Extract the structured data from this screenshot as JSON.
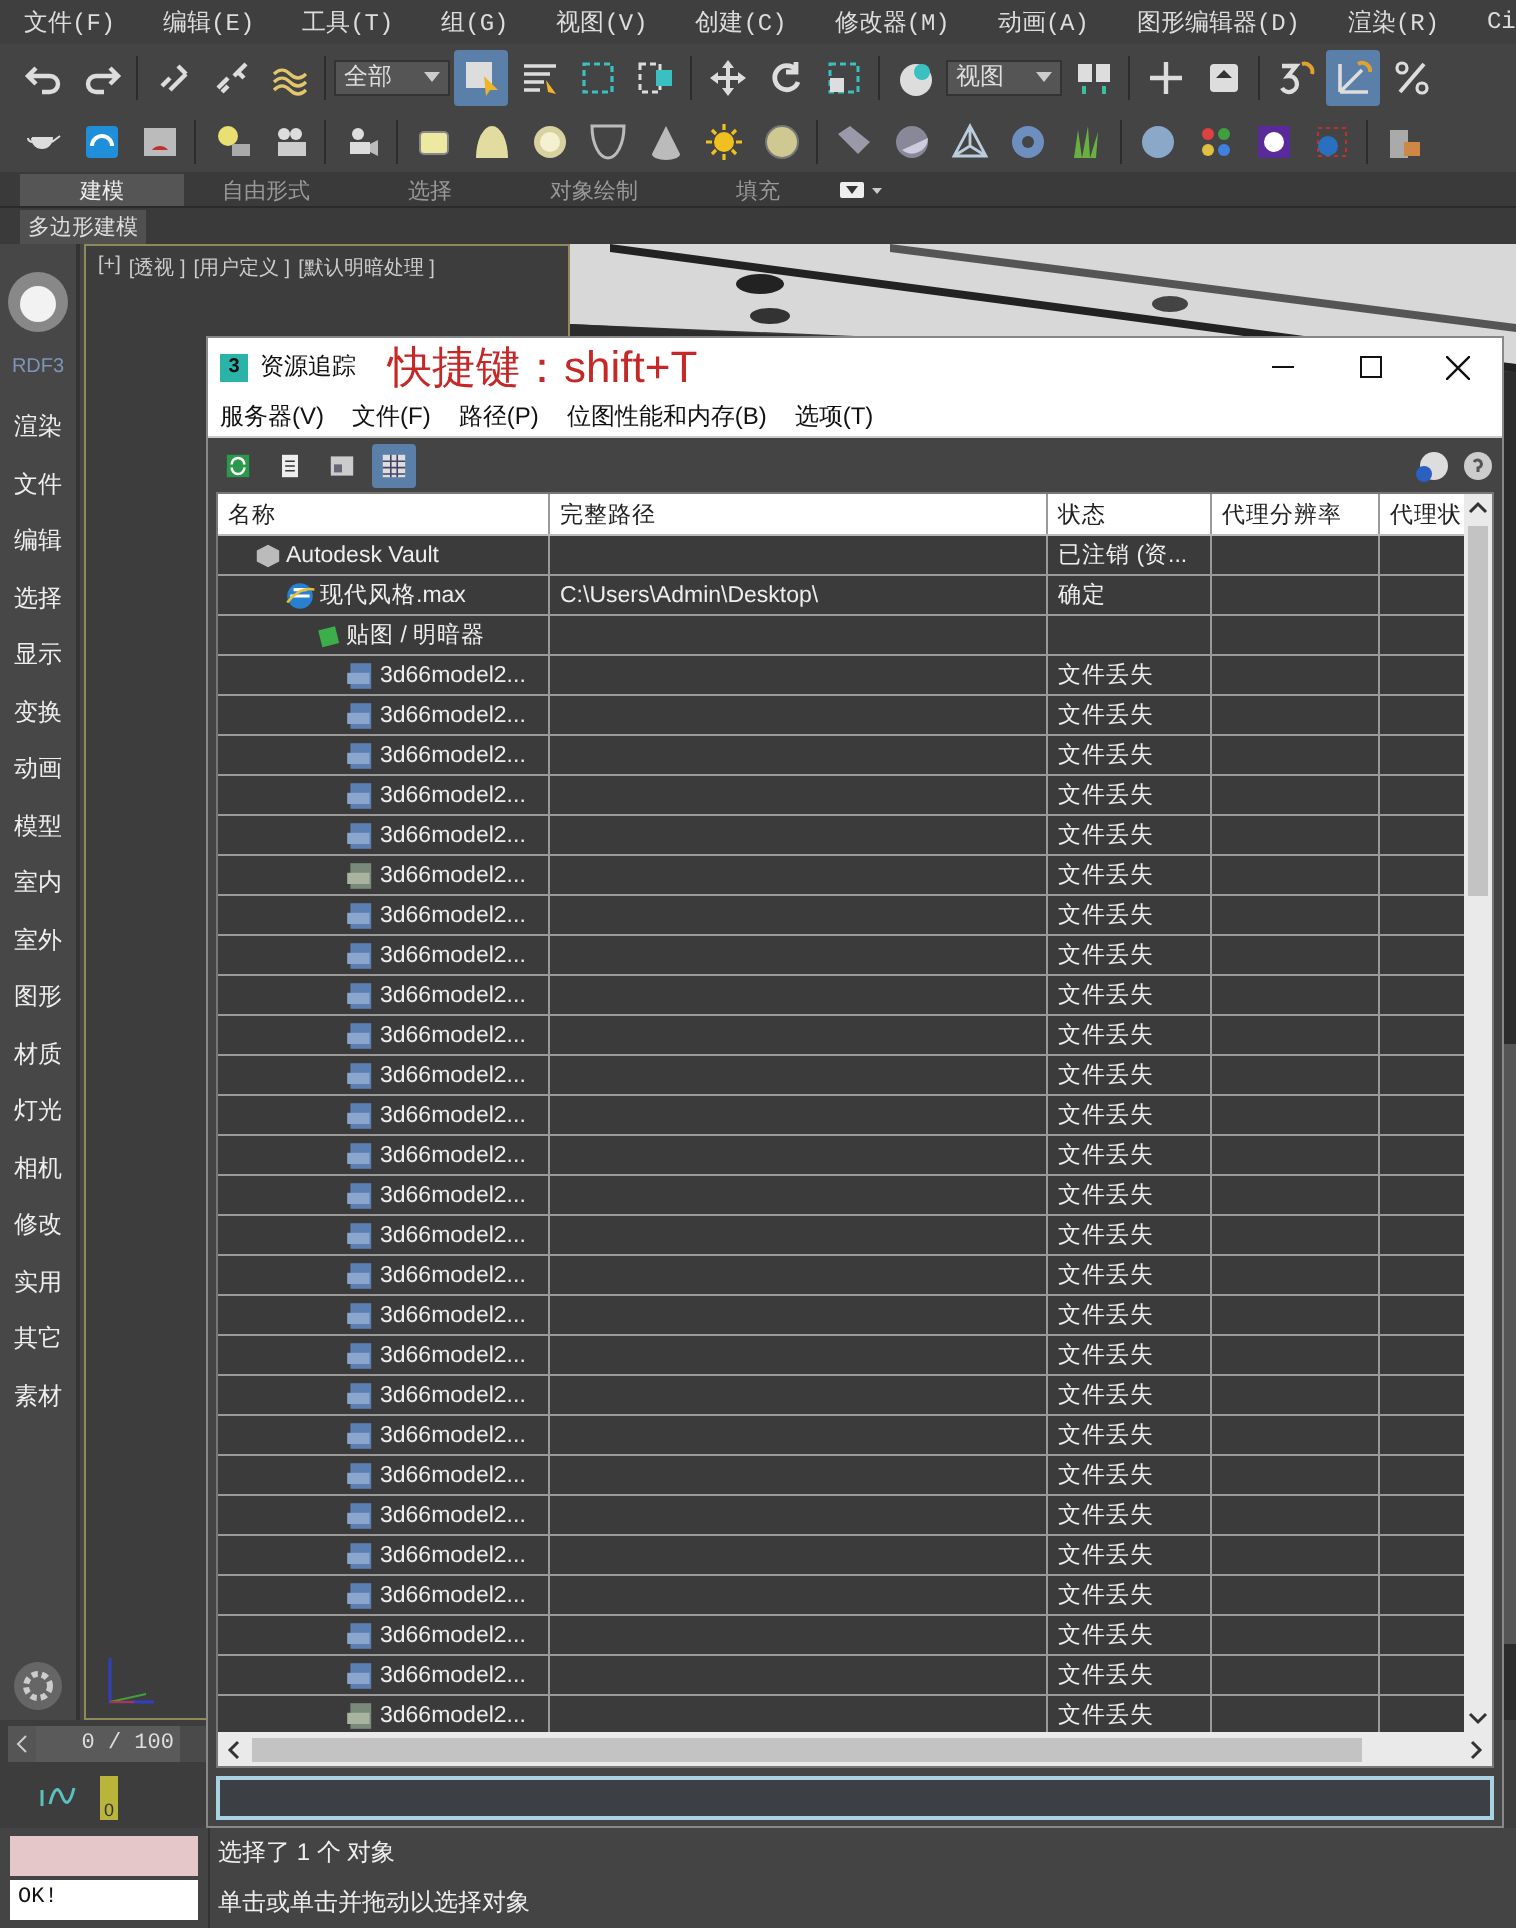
{
  "menu_bar": [
    "文件(F)",
    "编辑(E)",
    "工具(T)",
    "组(G)",
    "视图(V)",
    "创建(C)",
    "修改器(M)",
    "动画(A)",
    "图形编辑器(D)",
    "渲染(R)",
    "Ci"
  ],
  "main_toolbar": [
    {
      "kind": "icon",
      "selected": false
    },
    {
      "kind": "icon",
      "selected": false
    },
    {
      "kind": "separator"
    },
    {
      "kind": "icon",
      "selected": false
    },
    {
      "kind": "icon",
      "selected": false
    },
    {
      "kind": "icon",
      "selected": false
    },
    {
      "kind": "separator"
    },
    {
      "kind": "dropdown",
      "value": "全部"
    },
    {
      "kind": "icon",
      "selected": true
    },
    {
      "kind": "icon",
      "selected": false
    },
    {
      "kind": "icon",
      "selected": false
    },
    {
      "kind": "icon",
      "selected": false
    },
    {
      "kind": "separator"
    },
    {
      "kind": "icon",
      "selected": false
    },
    {
      "kind": "icon",
      "selected": false
    },
    {
      "kind": "icon",
      "selected": false
    },
    {
      "kind": "separator"
    },
    {
      "kind": "icon",
      "selected": false
    },
    {
      "kind": "dropdown",
      "value": "视图"
    },
    {
      "kind": "icon",
      "selected": false
    },
    {
      "kind": "separator"
    },
    {
      "kind": "icon",
      "selected": false
    },
    {
      "kind": "icon",
      "selected": false
    },
    {
      "kind": "separator"
    },
    {
      "kind": "icon",
      "selected": false
    },
    {
      "kind": "icon",
      "selected": true
    },
    {
      "kind": "icon",
      "selected": false
    }
  ],
  "ribbon_tabs": [
    {
      "label": "建模",
      "selected": true
    },
    {
      "label": "自由形式",
      "selected": false
    },
    {
      "label": "选择",
      "selected": false
    },
    {
      "label": "对象绘制",
      "selected": false
    },
    {
      "label": "填充",
      "selected": false
    }
  ],
  "ribbon_panel": "多边形建模",
  "sidebar": {
    "title": "RDF3",
    "items": [
      "渲染",
      "文件",
      "编辑",
      "选择",
      "显示",
      "变换",
      "动画",
      "模型",
      "室内",
      "室外",
      "图形",
      "材质",
      "灯光",
      "相机",
      "修改",
      "实用",
      "其它",
      "素材"
    ]
  },
  "viewport_labels": [
    "[+]",
    "[透视 ]",
    "[用户定义 ]",
    "[默认明暗处理 ]"
  ],
  "dialog": {
    "app_icon": "3",
    "title": "资源追踪",
    "annotation": "快捷键：shift+T",
    "menu": [
      "服务器(V)",
      "文件(F)",
      "路径(P)",
      "位图性能和内存(B)",
      "选项(T)"
    ],
    "toolbar": [
      {
        "selected": false
      },
      {
        "selected": false
      },
      {
        "selected": false
      },
      {
        "selected": true
      }
    ],
    "columns": [
      "名称",
      "完整路径",
      "状态",
      "代理分辨率",
      "代理状"
    ],
    "tree": [
      {
        "kind": "vault",
        "name": "Autodesk Vault",
        "status": "已注销 (资...",
        "children": [
          {
            "kind": "scene",
            "name": "现代风格.max",
            "path": "C:\\Users\\Admin\\Desktop\\",
            "status": "确定",
            "children": [
              {
                "kind": "folder",
                "name": "贴图 / 明暗器",
                "children": [
                  {
                    "kind": "jpg",
                    "name": "3d66model2...",
                    "status": "文件丢失"
                  },
                  {
                    "kind": "jpg",
                    "name": "3d66model2...",
                    "status": "文件丢失"
                  },
                  {
                    "kind": "jpg",
                    "name": "3d66model2...",
                    "status": "文件丢失"
                  },
                  {
                    "kind": "jpg",
                    "name": "3d66model2...",
                    "status": "文件丢失"
                  },
                  {
                    "kind": "jpg",
                    "name": "3d66model2...",
                    "status": "文件丢失"
                  },
                  {
                    "kind": "png",
                    "name": "3d66model2...",
                    "status": "文件丢失"
                  },
                  {
                    "kind": "jpg",
                    "name": "3d66model2...",
                    "status": "文件丢失"
                  },
                  {
                    "kind": "jpg",
                    "name": "3d66model2...",
                    "status": "文件丢失"
                  },
                  {
                    "kind": "jpg",
                    "name": "3d66model2...",
                    "status": "文件丢失"
                  },
                  {
                    "kind": "jpg",
                    "name": "3d66model2...",
                    "status": "文件丢失"
                  },
                  {
                    "kind": "jpg",
                    "name": "3d66model2...",
                    "status": "文件丢失"
                  },
                  {
                    "kind": "jpg",
                    "name": "3d66model2...",
                    "status": "文件丢失"
                  },
                  {
                    "kind": "jpg",
                    "name": "3d66model2...",
                    "status": "文件丢失"
                  },
                  {
                    "kind": "jpg",
                    "name": "3d66model2...",
                    "status": "文件丢失"
                  },
                  {
                    "kind": "jpg",
                    "name": "3d66model2...",
                    "status": "文件丢失"
                  },
                  {
                    "kind": "jpg",
                    "name": "3d66model2...",
                    "status": "文件丢失"
                  },
                  {
                    "kind": "jpg",
                    "name": "3d66model2...",
                    "status": "文件丢失"
                  },
                  {
                    "kind": "jpg",
                    "name": "3d66model2...",
                    "status": "文件丢失"
                  },
                  {
                    "kind": "jpg",
                    "name": "3d66model2...",
                    "status": "文件丢失"
                  },
                  {
                    "kind": "jpg",
                    "name": "3d66model2...",
                    "status": "文件丢失"
                  },
                  {
                    "kind": "jpg",
                    "name": "3d66model2...",
                    "status": "文件丢失"
                  },
                  {
                    "kind": "jpg",
                    "name": "3d66model2...",
                    "status": "文件丢失"
                  },
                  {
                    "kind": "jpg",
                    "name": "3d66model2...",
                    "status": "文件丢失"
                  },
                  {
                    "kind": "jpg",
                    "name": "3d66model2...",
                    "status": "文件丢失"
                  },
                  {
                    "kind": "jpg",
                    "name": "3d66model2...",
                    "status": "文件丢失"
                  },
                  {
                    "kind": "jpg",
                    "name": "3d66model2...",
                    "status": "文件丢失"
                  },
                  {
                    "kind": "png",
                    "name": "3d66model2...",
                    "status": "文件丢失"
                  }
                ]
              }
            ]
          }
        ]
      }
    ]
  },
  "time_slider": {
    "reading": "0 / 100",
    "level": 0
  },
  "track_bar": {
    "key": "0"
  },
  "status": {
    "field": "OK!",
    "lines": [
      "选择了 1 个 对象",
      "单击或单击并拖动以选择对象"
    ]
  }
}
